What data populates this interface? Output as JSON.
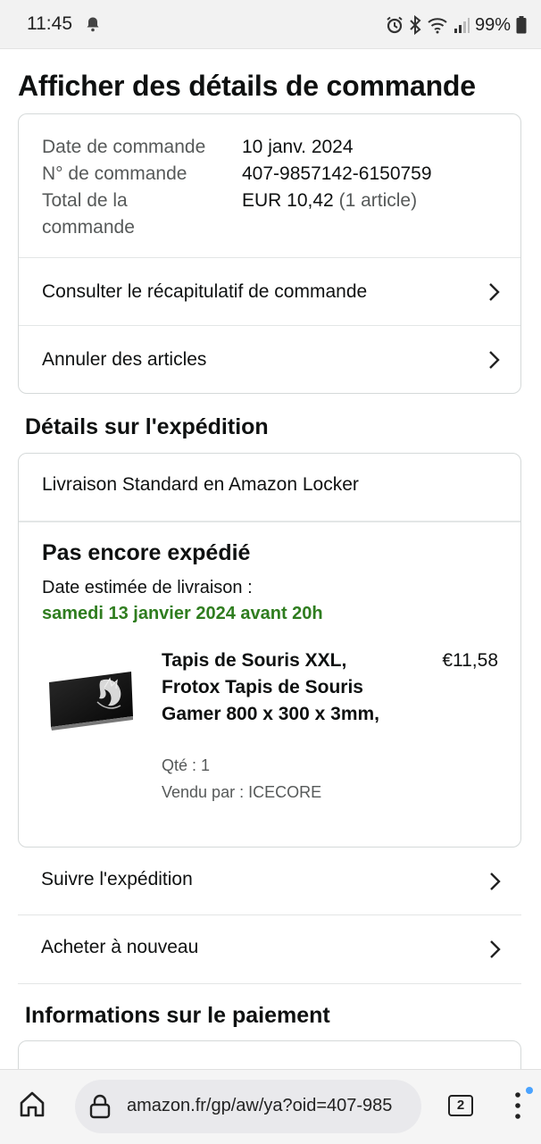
{
  "status_bar": {
    "time": "11:45",
    "battery": "99%",
    "icons": [
      "bell-icon",
      "alarm-icon",
      "bluetooth-icon",
      "wifi-icon",
      "signal-icon",
      "battery-icon"
    ]
  },
  "page": {
    "title": "Afficher des détails de commande"
  },
  "order_summary": {
    "date_label": "Date de commande",
    "date_value": "10 janv. 2024",
    "number_label": "N° de commande",
    "number_value": "407-9857142-6150759",
    "total_label_line1": "Total de la",
    "total_label_line2": "commande",
    "total_value": "EUR 10,42",
    "total_items": "(1 article)",
    "links": [
      {
        "label": "Consulter le récapitulatif de commande"
      },
      {
        "label": "Annuler des articles"
      }
    ]
  },
  "shipping": {
    "section_title": "Détails sur l'expédition",
    "method": "Livraison Standard en Amazon Locker",
    "status": "Pas encore expédié",
    "estimate_label": "Date estimée de livraison :",
    "estimate_date": "samedi 13 janvier 2024 avant 20h",
    "item": {
      "title": "Tapis de Souris XXL, Frotox Tapis de Souris Gamer 800 x 300 x 3mm,",
      "price": "€11,58",
      "quantity": "Qté : 1",
      "seller": "Vendu par : ICECORE"
    },
    "actions": [
      {
        "label": "Suivre l'expédition"
      },
      {
        "label": "Acheter à nouveau"
      }
    ]
  },
  "payment": {
    "section_title": "Informations sur le paiement"
  },
  "browser": {
    "url": "amazon.fr/gp/aw/ya?oid=407-985",
    "tab_count": "2"
  },
  "colors": {
    "delivery_green": "#2f7d1f",
    "border": "#d5d9d9",
    "muted_text": "#565959"
  }
}
